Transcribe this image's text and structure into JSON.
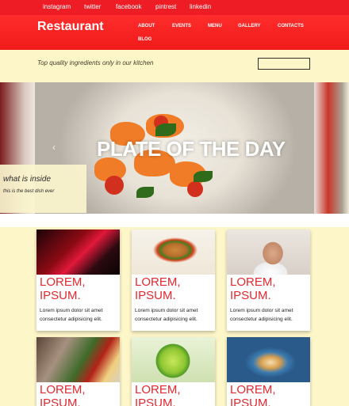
{
  "social": [
    "instagram",
    "twitter",
    "facebook",
    "pintrest",
    "linkedin"
  ],
  "brand": {
    "name": "Restaurant"
  },
  "nav": [
    "ABOUT",
    "EVENTS",
    "MENU",
    "GALLERY",
    "CONTACTS",
    "BLOG"
  ],
  "tagline": "Top quality ingredients only in our kitchen",
  "search": {
    "value": ""
  },
  "hero": {
    "title": "PLATE OF THE DAY",
    "prev_icon": "chevron-left-icon",
    "caption_title": "what is inside",
    "caption_text": "this is the best dish ever"
  },
  "cards": [
    {
      "title": "LOREM, IPSUM.",
      "text": "Lorem ipsum dolor sit amet consectetur adipisicing elit.",
      "image": "neon-open-sign"
    },
    {
      "title": "LOREM, IPSUM.",
      "text": "Lorem ipsum dolor sit amet consectetur adipisicing elit.",
      "image": "burger-and-fries"
    },
    {
      "title": "LOREM, IPSUM.",
      "text": "Lorem ipsum dolor sit amet consectetur adipisicing elit.",
      "image": "smiling-chef"
    },
    {
      "title": "LOREM, IPSUM.",
      "text": "",
      "image": "vegetables"
    },
    {
      "title": "LOREM, IPSUM.",
      "text": "",
      "image": "green-drink"
    },
    {
      "title": "LOREM, IPSUM.",
      "text": "",
      "image": "plated-dish"
    }
  ],
  "colors": {
    "header_red": "#ee1c25",
    "background_cream": "#fdf6c8",
    "card_title_red": "#e3282f"
  }
}
